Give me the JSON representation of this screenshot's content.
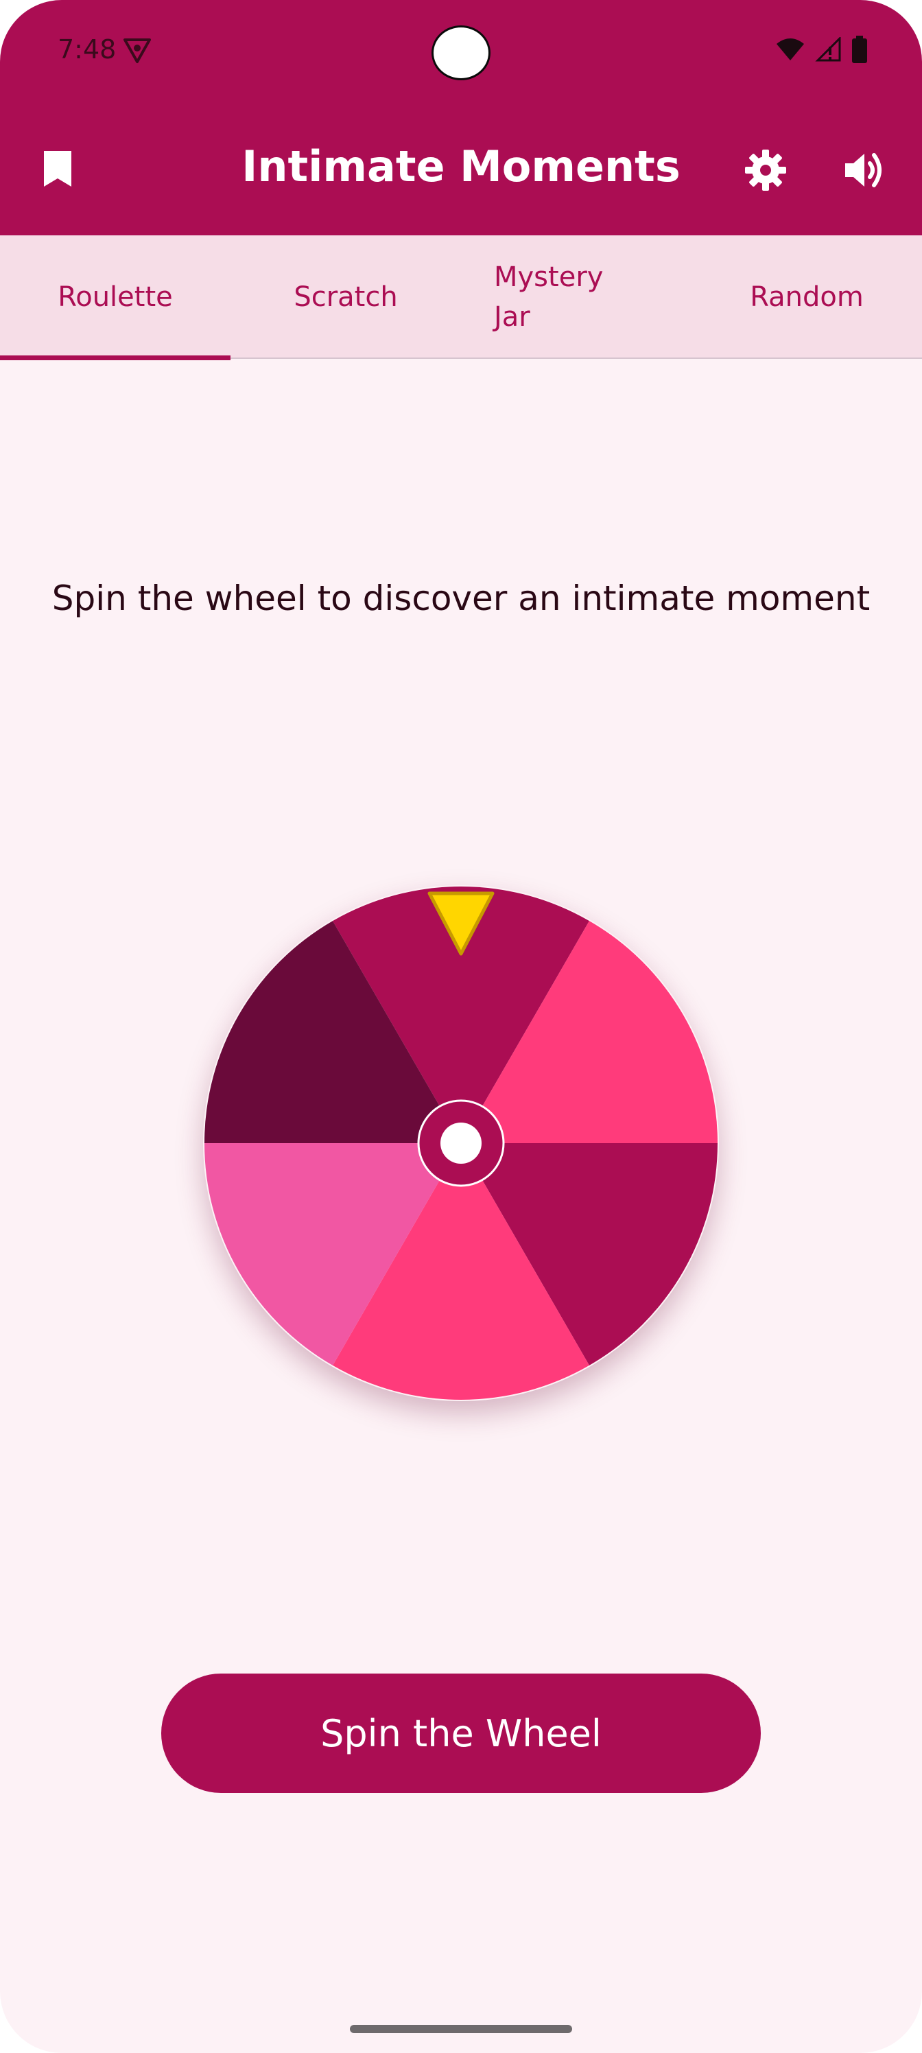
{
  "status_bar": {
    "time": "7:48"
  },
  "app_bar": {
    "title": "Intimate Moments",
    "left_icon": "bookmark-icon",
    "right_icons": [
      "gear-icon",
      "volume-icon"
    ]
  },
  "tabs": [
    {
      "label": "Roulette",
      "selected": true
    },
    {
      "label": "Scratch",
      "selected": false
    },
    {
      "label": "Mystery\nJar",
      "selected": false
    },
    {
      "label": "Random",
      "selected": false
    }
  ],
  "content": {
    "instruction": "Spin the wheel to discover an intimate moment",
    "wheel_segments": [
      {
        "color": "#ab0d53"
      },
      {
        "color": "#ff3b7b"
      },
      {
        "color": "#ab0d53"
      },
      {
        "color": "#ff3b7b"
      },
      {
        "color": "#f157a3"
      },
      {
        "color": "#6a0a3a"
      }
    ],
    "pointer_color": "#ffd600",
    "spin_button_label": "Spin the Wheel"
  },
  "colors": {
    "primary": "#ab0d53",
    "tab_background": "#f6dde7",
    "page_background": "#fdf2f6"
  }
}
